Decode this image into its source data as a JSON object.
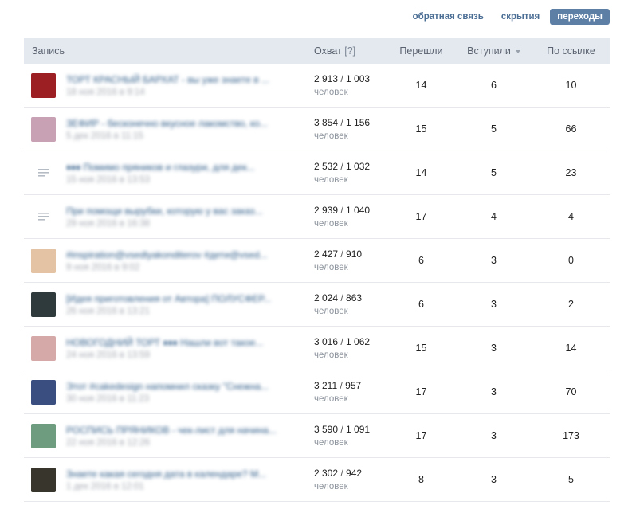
{
  "tabs": [
    {
      "label": "обратная связь",
      "active": false
    },
    {
      "label": "скрытия",
      "active": false
    },
    {
      "label": "переходы",
      "active": true
    }
  ],
  "table": {
    "headers": {
      "record": "Запись",
      "reach": "Охват",
      "reach_help": "[?]",
      "went": "Перешли",
      "joined": "Вступили",
      "by_link": "По ссылке"
    },
    "rows": [
      {
        "title": "ТОРТ КРАСНЫЙ БАРХАТ - вы уже знаете в ...",
        "date": "18 ноя 2016 в 9:14",
        "thumb": "photo",
        "thumb_color": "#9c1f24",
        "reach_total": "2 913",
        "reach_sub": "1 003",
        "unit": "человек",
        "went": "14",
        "joined": "6",
        "by_link": "10"
      },
      {
        "title": "ЗЕФИР - бесконечно вкусное лакомство, ко...",
        "date": "5 дек 2016 в 11:15",
        "thumb": "photo",
        "thumb_color": "#c8a1b4",
        "reach_total": "3 854",
        "reach_sub": "1 156",
        "unit": "человек",
        "went": "15",
        "joined": "5",
        "by_link": "66"
      },
      {
        "title": "♦♦♦ Помимо пряников и глазури, для дек...",
        "date": "15 ноя 2016 в 13:53",
        "thumb": "doc",
        "thumb_color": "#b6bcc4",
        "reach_total": "2 532",
        "reach_sub": "1 032",
        "unit": "человек",
        "went": "14",
        "joined": "5",
        "by_link": "23"
      },
      {
        "title": "При помощи вырубки, которую у вас заказ...",
        "date": "29 ноя 2016 в 16:38",
        "thumb": "doc",
        "thumb_color": "#b6bcc4",
        "reach_total": "2 939",
        "reach_sub": "1 040",
        "unit": "человек",
        "went": "17",
        "joined": "4",
        "by_link": "4"
      },
      {
        "title": "#inspiration@vsedlyakonditerov #дети@vsed...",
        "date": "9 ноя 2016 в 9:02",
        "thumb": "photo",
        "thumb_color": "#e3c3a3",
        "reach_total": "2 427",
        "reach_sub": "910",
        "unit": "человек",
        "went": "6",
        "joined": "3",
        "by_link": "0"
      },
      {
        "title": "[Идея приготовления от Автора] ПОЛУСФЕР...",
        "date": "26 ноя 2016 в 13:21",
        "thumb": "photo",
        "thumb_color": "#2e3a3c",
        "reach_total": "2 024",
        "reach_sub": "863",
        "unit": "человек",
        "went": "6",
        "joined": "3",
        "by_link": "2"
      },
      {
        "title": "НОВОГОДНИЙ ТОРТ ♦♦♦ Нашли вот такое...",
        "date": "24 ноя 2016 в 13:59",
        "thumb": "photo",
        "thumb_color": "#d6a9a9",
        "reach_total": "3 016",
        "reach_sub": "1 062",
        "unit": "человек",
        "went": "15",
        "joined": "3",
        "by_link": "14"
      },
      {
        "title": "Этот #cakedesign напомнил сказку \"Снежна...",
        "date": "30 ноя 2016 в 11:23",
        "thumb": "photo",
        "thumb_color": "#3b4e80",
        "reach_total": "3 211",
        "reach_sub": "957",
        "unit": "человек",
        "went": "17",
        "joined": "3",
        "by_link": "70"
      },
      {
        "title": "РОСПИСЬ ПРЯНИКОВ - чек-лист для начина...",
        "date": "22 ноя 2016 в 12:26",
        "thumb": "photo",
        "thumb_color": "#6d9d7e",
        "reach_total": "3 590",
        "reach_sub": "1 091",
        "unit": "человек",
        "went": "17",
        "joined": "3",
        "by_link": "173"
      },
      {
        "title": "Знаете какая сегодня дата в календаре? М...",
        "date": "1 дек 2016 в 12:01",
        "thumb": "photo",
        "thumb_color": "#37352c",
        "reach_total": "2 302",
        "reach_sub": "942",
        "unit": "человек",
        "went": "8",
        "joined": "3",
        "by_link": "5"
      }
    ]
  }
}
